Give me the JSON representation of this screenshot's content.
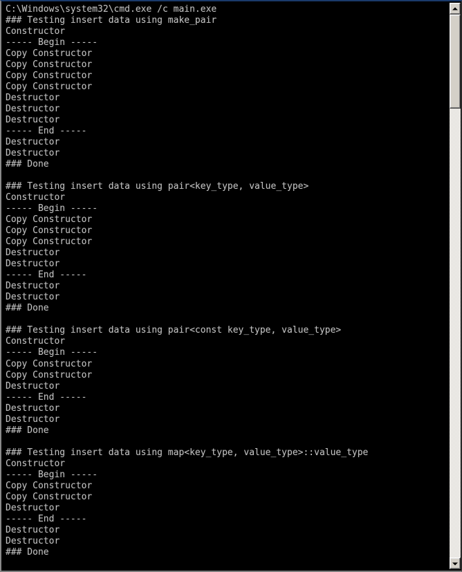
{
  "window": {
    "title": "C:\\Windows\\system32\\cmd.exe /c main.exe",
    "colors": {
      "background": "#000000",
      "foreground": "#c0c0c0",
      "scrollbar_face": "#d4d0c8",
      "border_top": "#1a3a6b"
    }
  },
  "scrollbar": {
    "up_arrow_icon": "triangle-up-icon",
    "down_arrow_icon": "triangle-down-icon",
    "thumb_label": "scroll-thumb",
    "position_percent": 0
  },
  "console": {
    "prompt_line": "C:\\Windows\\system32\\cmd.exe /c main.exe",
    "sections": [
      {
        "header": "### Testing insert data using make_pair",
        "lines": [
          "Constructor",
          "----- Begin -----",
          "Copy Constructor",
          "Copy Constructor",
          "Copy Constructor",
          "Copy Constructor",
          "Destructor",
          "Destructor",
          "Destructor",
          "----- End -----",
          "Destructor",
          "Destructor",
          "### Done"
        ]
      },
      {
        "header": "### Testing insert data using pair<key_type, value_type>",
        "lines": [
          "Constructor",
          "----- Begin -----",
          "Copy Constructor",
          "Copy Constructor",
          "Copy Constructor",
          "Destructor",
          "Destructor",
          "----- End -----",
          "Destructor",
          "Destructor",
          "### Done"
        ]
      },
      {
        "header": "### Testing insert data using pair<const key_type, value_type>",
        "lines": [
          "Constructor",
          "----- Begin -----",
          "Copy Constructor",
          "Copy Constructor",
          "Destructor",
          "----- End -----",
          "Destructor",
          "Destructor",
          "### Done"
        ]
      },
      {
        "header": "### Testing insert data using map<key_type, value_type>::value_type",
        "lines": [
          "Constructor",
          "----- Begin -----",
          "Copy Constructor",
          "Copy Constructor",
          "Destructor",
          "----- End -----",
          "Destructor",
          "Destructor",
          "### Done"
        ]
      }
    ],
    "full_text": "C:\\Windows\\system32\\cmd.exe /c main.exe\n### Testing insert data using make_pair\nConstructor\n----- Begin -----\nCopy Constructor\nCopy Constructor\nCopy Constructor\nCopy Constructor\nDestructor\nDestructor\nDestructor\n----- End -----\nDestructor\nDestructor\n### Done\n\n### Testing insert data using pair<key_type, value_type>\nConstructor\n----- Begin -----\nCopy Constructor\nCopy Constructor\nCopy Constructor\nDestructor\nDestructor\n----- End -----\nDestructor\nDestructor\n### Done\n\n### Testing insert data using pair<const key_type, value_type>\nConstructor\n----- Begin -----\nCopy Constructor\nCopy Constructor\nDestructor\n----- End -----\nDestructor\nDestructor\n### Done\n\n### Testing insert data using map<key_type, value_type>::value_type\nConstructor\n----- Begin -----\nCopy Constructor\nCopy Constructor\nDestructor\n----- End -----\nDestructor\nDestructor\n### Done"
  }
}
